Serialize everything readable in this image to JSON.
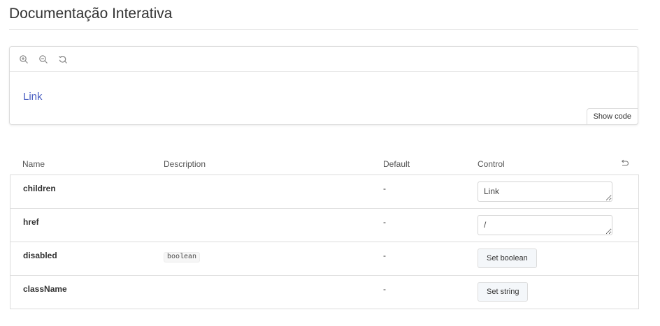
{
  "page": {
    "title": "Documentação Interativa"
  },
  "preview": {
    "toolbar": {
      "icons": [
        "zoom-in-icon",
        "zoom-out-icon",
        "reset-zoom-icon"
      ]
    },
    "link_label": "Link",
    "show_code_label": "Show code"
  },
  "args_table": {
    "headers": {
      "name": "Name",
      "description": "Description",
      "default": "Default",
      "control": "Control"
    },
    "reset_icon": "undo-icon",
    "rows": [
      {
        "name": "children",
        "description_type": "",
        "default": "-",
        "control_type": "text",
        "control_value": "Link"
      },
      {
        "name": "href",
        "description_type": "",
        "default": "-",
        "control_type": "text",
        "control_value": "/"
      },
      {
        "name": "disabled",
        "description_type": "boolean",
        "default": "-",
        "control_type": "button",
        "control_label": "Set boolean"
      },
      {
        "name": "className",
        "description_type": "",
        "default": "-",
        "control_type": "button",
        "control_label": "Set string"
      }
    ]
  },
  "colors": {
    "link": "#4a5fc1",
    "border": "#dcdcdc",
    "button_bg": "#f4f7fa"
  }
}
